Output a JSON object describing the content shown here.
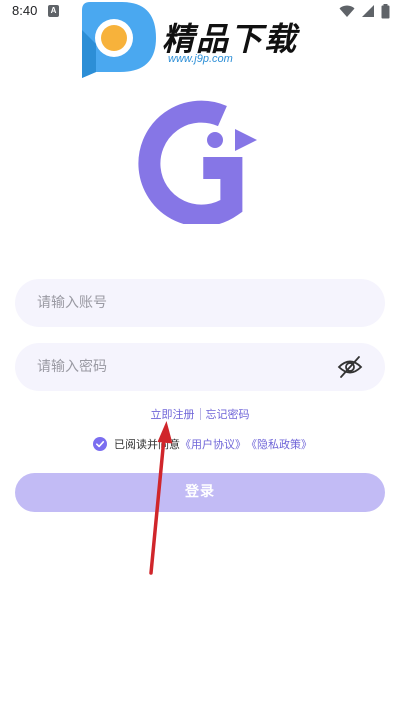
{
  "status_bar": {
    "time": "8:40",
    "notification_letter": "A"
  },
  "watermark": {
    "title": "精品下载",
    "url": "www.j9p.com"
  },
  "login_form": {
    "account_placeholder": "请输入账号",
    "password_placeholder": "请输入密码",
    "register_link": "立即注册",
    "forgot_link": "忘记密码",
    "agree_prefix": "已阅读并同意",
    "user_agreement": "《用户协议》",
    "privacy_policy": "《隐私政策》",
    "agree_checked": true,
    "login_button": "登录"
  },
  "colors": {
    "accent": "#7b6ef0",
    "logo": "#8676e6",
    "input_bg": "#f5f4fd",
    "login_button_bg": "#c2bbf5",
    "link": "#6f65d8",
    "annotation_arrow": "#d0262b"
  },
  "icons": {
    "logo": "g-bird-logo",
    "password_toggle": "eye-slash-icon",
    "checkbox": "check-circle-icon",
    "wifi": "wifi-icon",
    "signal": "signal-icon",
    "battery": "battery-icon"
  }
}
